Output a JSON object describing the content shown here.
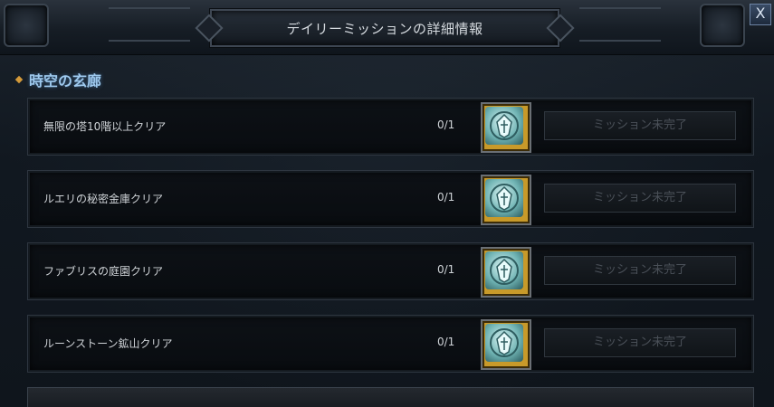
{
  "window": {
    "title": "デイリーミッションの詳細情報",
    "close_label": "X"
  },
  "section": {
    "title": "時空の玄廊"
  },
  "missions": [
    {
      "name": "無限の塔10階以上クリア",
      "progress": "0/1",
      "status": "ミッション未完了"
    },
    {
      "name": "ルエリの秘密金庫クリア",
      "progress": "0/1",
      "status": "ミッション未完了"
    },
    {
      "name": "ファブリスの庭園クリア",
      "progress": "0/1",
      "status": "ミッション未完了"
    },
    {
      "name": "ルーンストーン鉱山クリア",
      "progress": "0/1",
      "status": "ミッション未完了"
    }
  ],
  "icons": {
    "reward": "reward-emblem-icon",
    "close": "close-icon",
    "bullet": "diamond-bullet-icon"
  },
  "colors": {
    "section_title": "#9ec9ee",
    "reward_frame": "#c89a2a",
    "status_disabled_text": "#4a5058"
  }
}
